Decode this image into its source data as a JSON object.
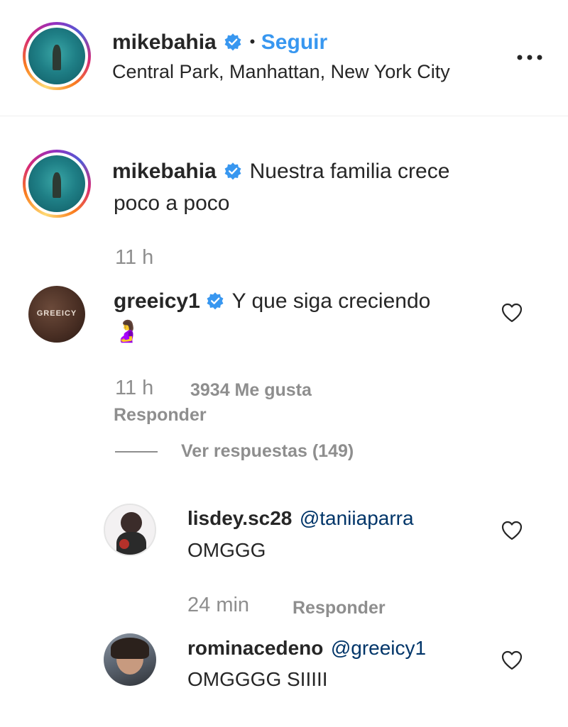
{
  "header": {
    "username": "mikebahia",
    "separator": "•",
    "follow_label": "Seguir",
    "location": "Central Park, Manhattan, New York City",
    "more_icon": "more-horizontal-icon"
  },
  "caption": {
    "username": "mikebahia",
    "text_line1": "Nuestra familia crece",
    "text_line2": "poco a poco",
    "time": "11 h"
  },
  "comments": [
    {
      "username": "greeicy1",
      "text": "Y que siga creciendo",
      "emoji": "🤰",
      "time": "11 h",
      "likes": "3934 Me gusta",
      "reply_label": "Responder",
      "view_replies": "Ver respuestas (149)",
      "avatar_text": "GREEICY"
    }
  ],
  "replies": [
    {
      "username": "lisdey.sc28",
      "mention": "@taniiaparra",
      "text": "OMGGG",
      "time": "24 min",
      "reply_label": "Responder"
    },
    {
      "username": "rominacedeno",
      "mention": "@greeicy1",
      "text": "OMGGGG SIIIII"
    }
  ],
  "colors": {
    "accent": "#3897f0",
    "verified": "#3897f0",
    "muted": "#8e8e8e",
    "text": "#262626",
    "mention": "#003569"
  }
}
